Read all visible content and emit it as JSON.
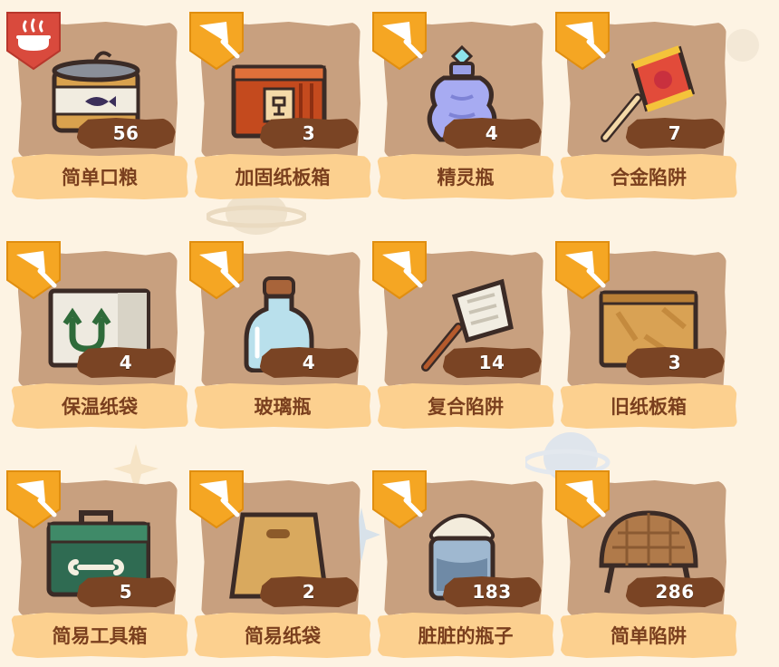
{
  "items": [
    {
      "name": "简单口粮",
      "count": "56",
      "tag": "food-pot-icon",
      "icon": "canned-food-icon"
    },
    {
      "name": "加固纸板箱",
      "count": "3",
      "tag": "net-icon",
      "icon": "reinforced-box-icon"
    },
    {
      "name": "精灵瓶",
      "count": "4",
      "tag": "net-icon",
      "icon": "spirit-bottle-icon"
    },
    {
      "name": "合金陷阱",
      "count": "7",
      "tag": "net-icon",
      "icon": "alloy-trap-icon"
    },
    {
      "name": "保温纸袋",
      "count": "4",
      "tag": "net-icon",
      "icon": "insulated-bag-icon"
    },
    {
      "name": "玻璃瓶",
      "count": "4",
      "tag": "net-icon",
      "icon": "glass-bottle-icon"
    },
    {
      "name": "复合陷阱",
      "count": "14",
      "tag": "net-icon",
      "icon": "composite-trap-icon"
    },
    {
      "name": "旧纸板箱",
      "count": "3",
      "tag": "net-icon",
      "icon": "old-box-icon"
    },
    {
      "name": "简易工具箱",
      "count": "5",
      "tag": "net-icon",
      "icon": "toolbox-icon"
    },
    {
      "name": "简易纸袋",
      "count": "2",
      "tag": "net-icon",
      "icon": "paper-bag-icon"
    },
    {
      "name": "脏脏的瓶子",
      "count": "183",
      "tag": "net-icon",
      "icon": "dirty-bottle-icon"
    },
    {
      "name": "简单陷阱",
      "count": "286",
      "tag": "net-icon",
      "icon": "simple-trap-icon"
    }
  ],
  "colors": {
    "background": "#fdf3e3",
    "panel": "#c8a07f",
    "label": "#fcd08f",
    "label_text": "#7a3f1e",
    "count_bg": "#7a4424",
    "tag_orange": "#f5a623",
    "tag_red": "#d94a3d"
  }
}
